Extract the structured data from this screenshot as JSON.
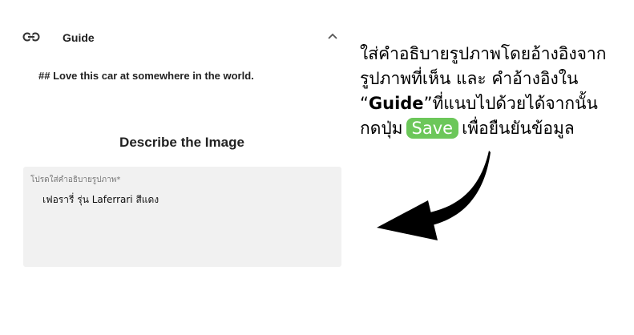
{
  "guide": {
    "title": "Guide",
    "body": "## Love this car at somewhere in the world."
  },
  "main": {
    "heading": "Describe the Image"
  },
  "description_field": {
    "label": "โปรดใส่คำอธิบายรูปภาพ*",
    "value": "เฟอรารี่ รุ่น Laferrari สีแดง"
  },
  "instruction": {
    "line1": "ใส่คำอธิบายรูปภาพโดยอ้างอิงจาก",
    "line2": "รูปภาพที่เห็น และ คำอ้างอิงใน",
    "line3_open_quote": "“",
    "line3_guide": "Guide",
    "line3_rest": "”ที่แนบไปด้วยได้จากนั้น",
    "line4_prefix": "กดปุ่ม",
    "save_badge": "Save",
    "line4_suffix": "เพื่อยืนยันข้อมูล"
  },
  "colors": {
    "save_badge": "#6cc75a",
    "field_background": "#f1f1f1",
    "arrow": "#000000"
  },
  "icons": [
    "link-icon",
    "chevron-up-icon",
    "curved-arrow-icon"
  ]
}
